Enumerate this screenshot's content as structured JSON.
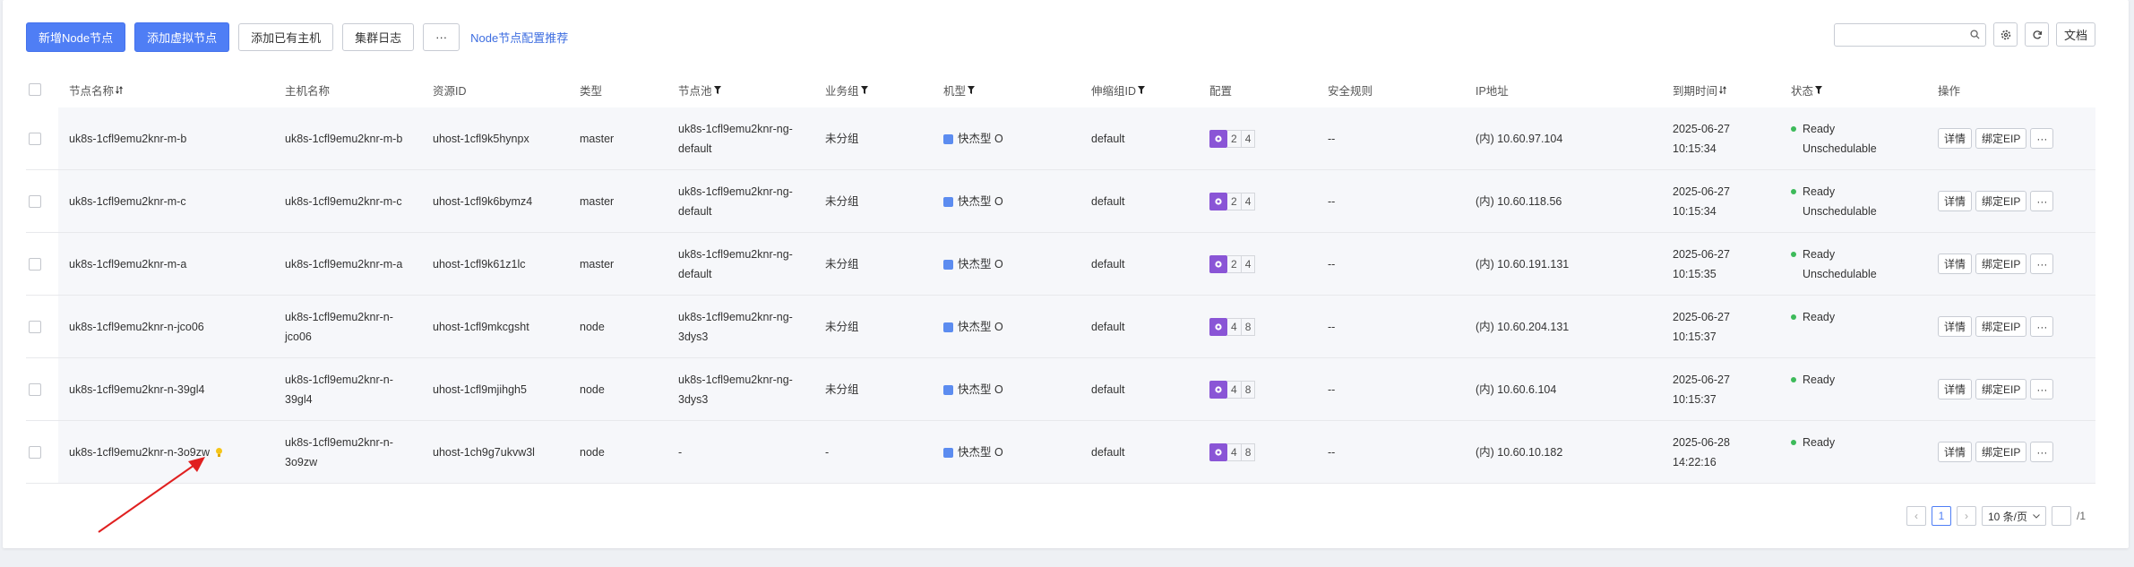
{
  "toolbar": {
    "add_node": "新增Node节点",
    "add_virtual": "添加虚拟节点",
    "add_existing": "添加已有主机",
    "cluster_log": "集群日志",
    "more": "···",
    "recommend_link": "Node节点配置推荐"
  },
  "right_tools": {
    "search_placeholder": "",
    "doc": "文档"
  },
  "columns": [
    "节点名称",
    "主机名称",
    "资源ID",
    "类型",
    "节点池",
    "业务组",
    "机型",
    "伸缩组ID",
    "配置",
    "安全规则",
    "IP地址",
    "到期时间",
    "状态",
    "操作"
  ],
  "rows": [
    {
      "name": "uk8s-1cfl9emu2knr-m-b",
      "host1": "uk8s-1cfl9emu2knr-m-b",
      "host2": "",
      "rid": "uhost-1cfl9k5hynpx",
      "type": "master",
      "pool1": "uk8s-1cfl9emu2knr-ng-",
      "pool2": "default",
      "group": "未分组",
      "model": "快杰型 O",
      "asg": "default",
      "cpu": "2",
      "mem": "4",
      "sec": "--",
      "ip": "(内) 10.60.97.104",
      "date": "2025-06-27",
      "time": "10:15:34",
      "st1": "Ready",
      "st2": "Unschedulable"
    },
    {
      "name": "uk8s-1cfl9emu2knr-m-c",
      "host1": "uk8s-1cfl9emu2knr-m-c",
      "host2": "",
      "rid": "uhost-1cfl9k6bymz4",
      "type": "master",
      "pool1": "uk8s-1cfl9emu2knr-ng-",
      "pool2": "default",
      "group": "未分组",
      "model": "快杰型 O",
      "asg": "default",
      "cpu": "2",
      "mem": "4",
      "sec": "--",
      "ip": "(内) 10.60.118.56",
      "date": "2025-06-27",
      "time": "10:15:34",
      "st1": "Ready",
      "st2": "Unschedulable"
    },
    {
      "name": "uk8s-1cfl9emu2knr-m-a",
      "host1": "uk8s-1cfl9emu2knr-m-a",
      "host2": "",
      "rid": "uhost-1cfl9k61z1lc",
      "type": "master",
      "pool1": "uk8s-1cfl9emu2knr-ng-",
      "pool2": "default",
      "group": "未分组",
      "model": "快杰型 O",
      "asg": "default",
      "cpu": "2",
      "mem": "4",
      "sec": "--",
      "ip": "(内) 10.60.191.131",
      "date": "2025-06-27",
      "time": "10:15:35",
      "st1": "Ready",
      "st2": "Unschedulable"
    },
    {
      "name": "uk8s-1cfl9emu2knr-n-jco06",
      "host1": "uk8s-1cfl9emu2knr-n-",
      "host2": "jco06",
      "rid": "uhost-1cfl9mkcgsht",
      "type": "node",
      "pool1": "uk8s-1cfl9emu2knr-ng-",
      "pool2": "3dys3",
      "group": "未分组",
      "model": "快杰型 O",
      "asg": "default",
      "cpu": "4",
      "mem": "8",
      "sec": "--",
      "ip": "(内) 10.60.204.131",
      "date": "2025-06-27",
      "time": "10:15:37",
      "st1": "Ready",
      "st2": ""
    },
    {
      "name": "uk8s-1cfl9emu2knr-n-39gl4",
      "host1": "uk8s-1cfl9emu2knr-n-",
      "host2": "39gl4",
      "rid": "uhost-1cfl9mjihgh5",
      "type": "node",
      "pool1": "uk8s-1cfl9emu2knr-ng-",
      "pool2": "3dys3",
      "group": "未分组",
      "model": "快杰型 O",
      "asg": "default",
      "cpu": "4",
      "mem": "8",
      "sec": "--",
      "ip": "(内) 10.60.6.104",
      "date": "2025-06-27",
      "time": "10:15:37",
      "st1": "Ready",
      "st2": ""
    },
    {
      "name": "uk8s-1cfl9emu2knr-n-3o9zw",
      "host1": "uk8s-1cfl9emu2knr-n-",
      "host2": "3o9zw",
      "rid": "uhost-1ch9g7ukvw3l",
      "type": "node",
      "pool1": "-",
      "pool2": "",
      "group": "-",
      "model": "快杰型 O",
      "asg": "default",
      "cpu": "4",
      "mem": "8",
      "sec": "--",
      "ip": "(内) 10.60.10.182",
      "date": "2025-06-28",
      "time": "14:22:16",
      "st1": "Ready",
      "st2": ""
    }
  ],
  "ops": {
    "detail": "详情",
    "bind": "绑定EIP",
    "more": "···"
  },
  "pager": {
    "page": "1",
    "size": "10 条/页",
    "total": "/1"
  },
  "colors": {
    "primary": "#4f7ef5",
    "ready": "#3dba5a",
    "config": "#8a55d6",
    "arrow": "#e02020",
    "bulb": "#f5c518"
  }
}
